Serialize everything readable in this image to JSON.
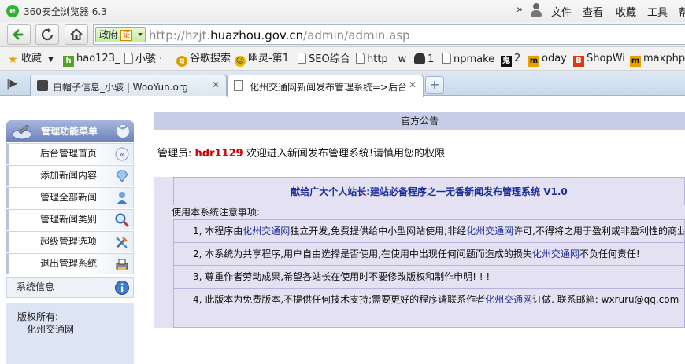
{
  "browser": {
    "title": "360安全浏览器 6.3",
    "menu": [
      "»",
      "文件",
      "查看",
      "收藏",
      "工具",
      "帮"
    ],
    "cert_label": "政府",
    "cert_badge": "证",
    "url_prefix": "http://hzjt.",
    "url_domain": "huazhou.gov.cn",
    "url_path": "/admin/admin.asp",
    "favorites": [
      {
        "label": "收藏",
        "icon": "star-icon"
      },
      {
        "label": "hao123_",
        "icon": "hao123-icon"
      },
      {
        "label": "小骇 ·",
        "icon": "page-icon"
      },
      {
        "label": "谷歌搜索",
        "icon": "google-icon"
      },
      {
        "label": "幽灵-第1",
        "icon": "ghost-icon"
      },
      {
        "label": "SEO综合",
        "icon": "page-icon"
      },
      {
        "label": "http__w",
        "icon": "page-icon"
      },
      {
        "label": "1",
        "icon": "person-icon"
      },
      {
        "label": "npmake",
        "icon": "page-icon"
      },
      {
        "label": "2",
        "icon": "game-icon"
      },
      {
        "label": "oday",
        "icon": "m-icon"
      },
      {
        "label": "ShopWi",
        "icon": "b-icon"
      },
      {
        "label": "maxphp",
        "icon": "m-icon"
      }
    ],
    "tabs": [
      {
        "label": "白帽子信息_小骇 | WooYun.org",
        "active": false
      },
      {
        "label": "化州交通网新闻发布管理系统=>后台",
        "active": true
      }
    ]
  },
  "sidebar": {
    "header": "管理功能菜单",
    "items": [
      {
        "label": "后台管理首页",
        "icon": "collapse-icon"
      },
      {
        "label": "添加新闻内容",
        "icon": "diamond-icon"
      },
      {
        "label": "管理全部新闻",
        "icon": "user-icon"
      },
      {
        "label": "管理新闻类别",
        "icon": "search-icon"
      },
      {
        "label": "超级管理选项",
        "icon": "tools-icon"
      },
      {
        "label": "退出管理系统",
        "icon": "printer-icon"
      }
    ],
    "system": "系统信息",
    "copyright_label": "版权所有:",
    "copyright_owner": "化州交通网"
  },
  "main": {
    "notice": "官方公告",
    "welcome_prefix": "管理员:",
    "username": "hdr1129",
    "welcome_suffix": "欢迎进入新闻发布管理系统!请慎用您的权限",
    "box_title": "献给广大个人站长:建站必备程序之一无香新闻发布管理系统  V1.0",
    "box_sub": "使用本系统注意事项:",
    "rows": [
      {
        "a": "1, 本程序由",
        "link": "化州交通网",
        "b": "独立开发,免费提供给中小型网站使用;非经",
        "link2": "化州交通网",
        "c": "许可,不得将之用于盈利或非盈利性的商业"
      },
      {
        "a": "2, 本系统为共享程序,用户自由选择是否使用,在使用中出现任何问题而造成的损失",
        "link": "化州交通网",
        "b": "不负任何责任!",
        "link2": "",
        "c": ""
      },
      {
        "a": "3, 尊重作者劳动成果,希望各站长在使用时不要修改版权和制作申明! ! !",
        "link": "",
        "b": "",
        "link2": "",
        "c": ""
      },
      {
        "a": "4, 此版本为免费版本,不提供任何技术支持;需要更好的程序请联系作者",
        "link": "化州交通网",
        "b": "订做. 联系邮箱:  wxruru@qq.com",
        "link2": "",
        "c": ""
      }
    ]
  }
}
